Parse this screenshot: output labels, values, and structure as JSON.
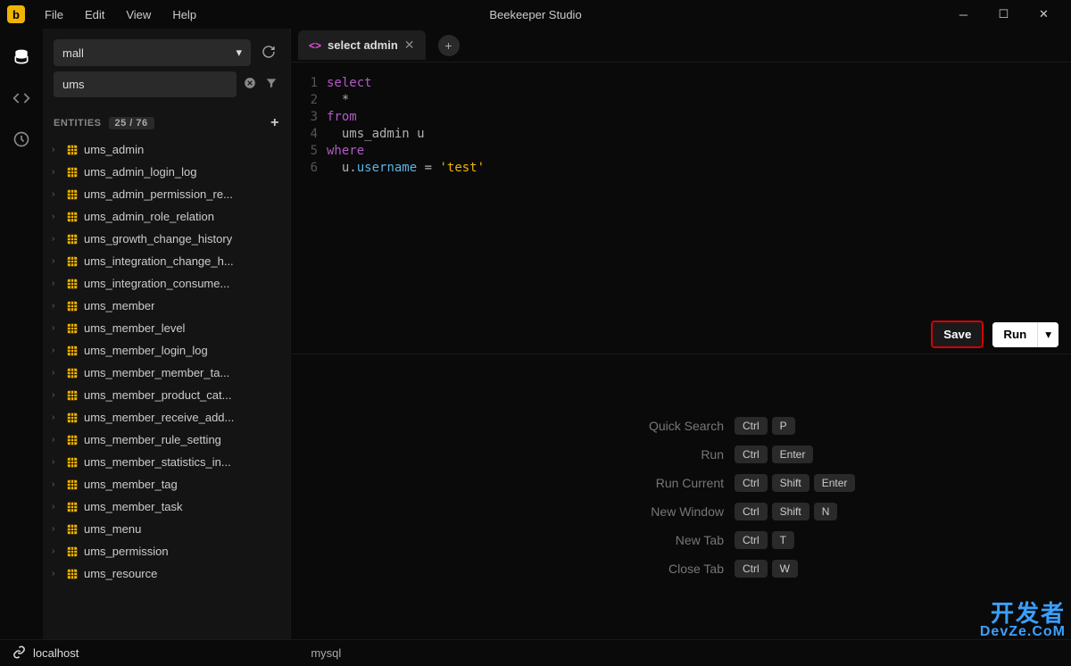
{
  "titlebar": {
    "app_title": "Beekeeper Studio",
    "menu": [
      "File",
      "Edit",
      "View",
      "Help"
    ]
  },
  "sidebar": {
    "db_selected": "mall",
    "filter_value": "ums",
    "entities_label": "ENTITIES",
    "entities_count": "25 / 76",
    "entities": [
      "ums_admin",
      "ums_admin_login_log",
      "ums_admin_permission_re...",
      "ums_admin_role_relation",
      "ums_growth_change_history",
      "ums_integration_change_h...",
      "ums_integration_consume...",
      "ums_member",
      "ums_member_level",
      "ums_member_login_log",
      "ums_member_member_ta...",
      "ums_member_product_cat...",
      "ums_member_receive_add...",
      "ums_member_rule_setting",
      "ums_member_statistics_in...",
      "ums_member_tag",
      "ums_member_task",
      "ums_menu",
      "ums_permission",
      "ums_resource"
    ]
  },
  "tabs": {
    "active_label": "select admin"
  },
  "editor": {
    "lines": [
      [
        {
          "t": "select",
          "c": "kw"
        }
      ],
      [
        {
          "t": "  *",
          "c": ""
        }
      ],
      [
        {
          "t": "from",
          "c": "kw"
        }
      ],
      [
        {
          "t": "  ums_admin u",
          "c": ""
        }
      ],
      [
        {
          "t": "where",
          "c": "kw"
        }
      ],
      [
        {
          "t": "  u",
          "c": ""
        },
        {
          "t": ".",
          "c": ""
        },
        {
          "t": "username",
          "c": "id-tok"
        },
        {
          "t": " = ",
          "c": ""
        },
        {
          "t": "'test'",
          "c": "str"
        }
      ]
    ]
  },
  "actions": {
    "save_label": "Save",
    "run_label": "Run"
  },
  "shortcuts": [
    {
      "label": "Quick Search",
      "keys": [
        "Ctrl",
        "P"
      ]
    },
    {
      "label": "Run",
      "keys": [
        "Ctrl",
        "Enter"
      ]
    },
    {
      "label": "Run Current",
      "keys": [
        "Ctrl",
        "Shift",
        "Enter"
      ]
    },
    {
      "label": "New Window",
      "keys": [
        "Ctrl",
        "Shift",
        "N"
      ]
    },
    {
      "label": "New Tab",
      "keys": [
        "Ctrl",
        "T"
      ]
    },
    {
      "label": "Close Tab",
      "keys": [
        "Ctrl",
        "W"
      ]
    }
  ],
  "statusbar": {
    "host": "localhost",
    "db_type": "mysql"
  },
  "watermark": {
    "cn": "开发者",
    "en": "DevZe.CoM"
  }
}
